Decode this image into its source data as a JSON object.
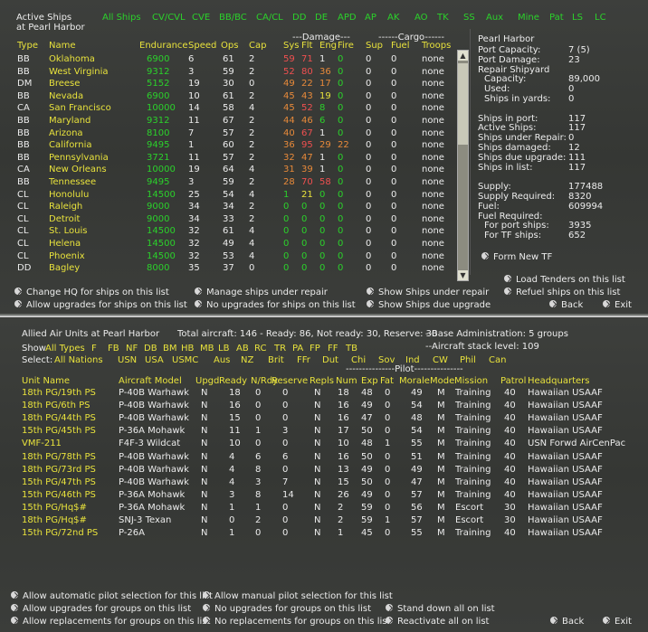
{
  "top": {
    "title_line1": "Active Ships",
    "title_line2": "at Pearl Harbor",
    "filters": [
      "All Ships",
      "CV/CVL",
      "CVE",
      "BB/BC",
      "CA/CL",
      "DD",
      "DE",
      "APD",
      "AP",
      "AK",
      "AO",
      "TK",
      "SS",
      "Aux",
      "Mine",
      "Pat",
      "LS",
      "LC"
    ],
    "damage_group": "---Damage---",
    "cargo_group": "------Cargo------",
    "columns": [
      "Type",
      "Name",
      "Endurance",
      "Speed",
      "Ops",
      "Cap",
      "Sys",
      "Flt",
      "Eng",
      "Fire",
      "Sup",
      "Fuel",
      "Troops"
    ],
    "ships": [
      {
        "type": "BB",
        "name": "Oklahoma",
        "end": "6900",
        "spd": "6",
        "ops": "61",
        "cap": "2",
        "sys": "59",
        "flt": "71",
        "eng": "1",
        "fire": "0",
        "sup": "0",
        "fuel": "0",
        "troops": "none",
        "sc": "rd",
        "fc": "rd",
        "ec": "wh",
        "xc": "gr"
      },
      {
        "type": "BB",
        "name": "West Virginia",
        "end": "9312",
        "spd": "3",
        "ops": "59",
        "cap": "2",
        "sys": "52",
        "flt": "80",
        "eng": "36",
        "fire": "0",
        "sup": "0",
        "fuel": "0",
        "troops": "none",
        "sc": "rd",
        "fc": "rd",
        "ec": "or",
        "xc": "gr"
      },
      {
        "type": "DM",
        "name": "Breese",
        "end": "5152",
        "spd": "19",
        "ops": "30",
        "cap": "0",
        "sys": "49",
        "flt": "22",
        "eng": "17",
        "fire": "0",
        "sup": "0",
        "fuel": "0",
        "troops": "none",
        "sc": "or",
        "fc": "or",
        "ec": "or",
        "xc": "gr"
      },
      {
        "type": "BB",
        "name": "Nevada",
        "end": "6900",
        "spd": "10",
        "ops": "61",
        "cap": "2",
        "sys": "45",
        "flt": "43",
        "eng": "19",
        "fire": "0",
        "sup": "0",
        "fuel": "0",
        "troops": "none",
        "sc": "or",
        "fc": "or",
        "ec": "ye",
        "xc": "gr"
      },
      {
        "type": "CA",
        "name": "San Francisco",
        "end": "10000",
        "spd": "14",
        "ops": "58",
        "cap": "4",
        "sys": "45",
        "flt": "52",
        "eng": "8",
        "fire": "0",
        "sup": "0",
        "fuel": "0",
        "troops": "none",
        "sc": "or",
        "fc": "rd",
        "ec": "gr",
        "xc": "gr"
      },
      {
        "type": "BB",
        "name": "Maryland",
        "end": "9312",
        "spd": "11",
        "ops": "67",
        "cap": "2",
        "sys": "44",
        "flt": "46",
        "eng": "6",
        "fire": "0",
        "sup": "0",
        "fuel": "0",
        "troops": "none",
        "sc": "or",
        "fc": "or",
        "ec": "gr",
        "xc": "gr"
      },
      {
        "type": "BB",
        "name": "Arizona",
        "end": "8100",
        "spd": "7",
        "ops": "57",
        "cap": "2",
        "sys": "40",
        "flt": "67",
        "eng": "1",
        "fire": "0",
        "sup": "0",
        "fuel": "0",
        "troops": "none",
        "sc": "or",
        "fc": "rd",
        "ec": "wh",
        "xc": "gr"
      },
      {
        "type": "BB",
        "name": "California",
        "end": "9495",
        "spd": "1",
        "ops": "60",
        "cap": "2",
        "sys": "36",
        "flt": "95",
        "eng": "29",
        "fire": "22",
        "sup": "0",
        "fuel": "0",
        "troops": "none",
        "sc": "or",
        "fc": "rd",
        "ec": "or",
        "xc": "or"
      },
      {
        "type": "BB",
        "name": "Pennsylvania",
        "end": "3721",
        "spd": "11",
        "ops": "57",
        "cap": "2",
        "sys": "32",
        "flt": "47",
        "eng": "1",
        "fire": "0",
        "sup": "0",
        "fuel": "0",
        "troops": "none",
        "sc": "or",
        "fc": "or",
        "ec": "wh",
        "xc": "gr"
      },
      {
        "type": "CA",
        "name": "New Orleans",
        "end": "10000",
        "spd": "19",
        "ops": "64",
        "cap": "4",
        "sys": "31",
        "flt": "39",
        "eng": "1",
        "fire": "0",
        "sup": "0",
        "fuel": "0",
        "troops": "none",
        "sc": "or",
        "fc": "or",
        "ec": "wh",
        "xc": "gr"
      },
      {
        "type": "BB",
        "name": "Tennessee",
        "end": "9495",
        "spd": "3",
        "ops": "59",
        "cap": "2",
        "sys": "28",
        "flt": "70",
        "eng": "58",
        "fire": "0",
        "sup": "0",
        "fuel": "0",
        "troops": "none",
        "sc": "or",
        "fc": "rd",
        "ec": "rd",
        "xc": "gr"
      },
      {
        "type": "CL",
        "name": "Honolulu",
        "end": "14500",
        "spd": "25",
        "ops": "54",
        "cap": "4",
        "sys": "1",
        "flt": "21",
        "eng": "0",
        "fire": "0",
        "sup": "0",
        "fuel": "0",
        "troops": "none",
        "sc": "gr",
        "fc": "ye",
        "ec": "gr",
        "xc": "gr"
      },
      {
        "type": "CL",
        "name": "Raleigh",
        "end": "9000",
        "spd": "34",
        "ops": "34",
        "cap": "2",
        "sys": "0",
        "flt": "0",
        "eng": "0",
        "fire": "0",
        "sup": "0",
        "fuel": "0",
        "troops": "none",
        "sc": "gr",
        "fc": "gr",
        "ec": "gr",
        "xc": "gr"
      },
      {
        "type": "CL",
        "name": "Detroit",
        "end": "9000",
        "spd": "34",
        "ops": "33",
        "cap": "2",
        "sys": "0",
        "flt": "0",
        "eng": "0",
        "fire": "0",
        "sup": "0",
        "fuel": "0",
        "troops": "none",
        "sc": "gr",
        "fc": "gr",
        "ec": "gr",
        "xc": "gr"
      },
      {
        "type": "CL",
        "name": "St. Louis",
        "end": "14500",
        "spd": "32",
        "ops": "61",
        "cap": "4",
        "sys": "0",
        "flt": "0",
        "eng": "0",
        "fire": "0",
        "sup": "0",
        "fuel": "0",
        "troops": "none",
        "sc": "gr",
        "fc": "gr",
        "ec": "gr",
        "xc": "gr"
      },
      {
        "type": "CL",
        "name": "Helena",
        "end": "14500",
        "spd": "32",
        "ops": "49",
        "cap": "4",
        "sys": "0",
        "flt": "0",
        "eng": "0",
        "fire": "0",
        "sup": "0",
        "fuel": "0",
        "troops": "none",
        "sc": "gr",
        "fc": "gr",
        "ec": "gr",
        "xc": "gr"
      },
      {
        "type": "CL",
        "name": "Phoenix",
        "end": "14500",
        "spd": "32",
        "ops": "53",
        "cap": "4",
        "sys": "0",
        "flt": "0",
        "eng": "0",
        "fire": "0",
        "sup": "0",
        "fuel": "0",
        "troops": "none",
        "sc": "gr",
        "fc": "gr",
        "ec": "gr",
        "xc": "gr"
      },
      {
        "type": "DD",
        "name": "Bagley",
        "end": "8000",
        "spd": "35",
        "ops": "37",
        "cap": "0",
        "sys": "0",
        "flt": "0",
        "eng": "0",
        "fire": "0",
        "sup": "0",
        "fuel": "0",
        "troops": "none",
        "sc": "gr",
        "fc": "gr",
        "ec": "gr",
        "xc": "gr"
      }
    ],
    "base": {
      "name": "Pearl Harbor",
      "rows": [
        {
          "label": "Port Capacity:",
          "value": "7 (5)",
          "indent": 0
        },
        {
          "label": "Port Damage:",
          "value": "23",
          "indent": 0
        },
        {
          "label": "Repair Shipyard",
          "value": "",
          "indent": 0
        },
        {
          "label": "Capacity:",
          "value": "89,000",
          "indent": 1
        },
        {
          "label": "Used:",
          "value": "0",
          "indent": 1
        },
        {
          "label": "Ships in yards:",
          "value": "0",
          "indent": 1
        },
        {
          "label": "",
          "value": "",
          "indent": 0
        },
        {
          "label": "Ships in port:",
          "value": "117",
          "indent": 0
        },
        {
          "label": "Active Ships:",
          "value": "117",
          "indent": 0
        },
        {
          "label": "Ships under Repair:",
          "value": "0",
          "indent": 0
        },
        {
          "label": "Ships damaged:",
          "value": "12",
          "indent": 0
        },
        {
          "label": "Ships due upgrade:",
          "value": "111",
          "indent": 0
        },
        {
          "label": "Ships in list:",
          "value": "117",
          "indent": 0
        },
        {
          "label": "",
          "value": "",
          "indent": 0
        },
        {
          "label": "Supply:",
          "value": "177488",
          "indent": 0
        },
        {
          "label": "Supply Required:",
          "value": "8320",
          "indent": 0
        },
        {
          "label": "Fuel:",
          "value": "609994",
          "indent": 0
        },
        {
          "label": "Fuel Required:",
          "value": "",
          "indent": 0
        },
        {
          "label": "For port ships:",
          "value": "3935",
          "indent": 1
        },
        {
          "label": "For TF ships:",
          "value": "652",
          "indent": 1
        }
      ],
      "form_new_tf": "Form New TF"
    },
    "buttons": {
      "change_hq": "Change HQ for ships on this list",
      "manage_repair": "Manage ships under repair",
      "show_repair": "Show Ships under repair",
      "load_tenders": "Load Tenders on this list",
      "allow_upgrades": "Allow upgrades for ships on this list",
      "no_upgrades": "No upgrades for ships on this list",
      "show_upgrade": "Show Ships due upgrade",
      "refuel": "Refuel ships on this list",
      "back": "Back",
      "exit": "Exit"
    }
  },
  "air": {
    "title": "Allied Air Units at Pearl Harbor",
    "summary": "Total aircraft: 146 - Ready: 86, Not ready: 30, Reserve: 30",
    "base_admin": "--Base Administration: 5 groups",
    "stack_level": "--Aircraft stack level: 109",
    "show_label": "Show",
    "show_filters": [
      "All Types",
      "F",
      "FB",
      "NF",
      "DB",
      "BM",
      "HB",
      "MB",
      "LB",
      "AB",
      "RC",
      "TR",
      "PA",
      "FP",
      "FF",
      "TB"
    ],
    "select_label": "Select:",
    "select_filters": [
      "All Nations",
      "USN",
      "USA",
      "USMC",
      "Aus",
      "NZ",
      "Brit",
      "FFr",
      "Dut",
      "Chi",
      "Sov",
      "Ind",
      "CW",
      "Phil",
      "Can"
    ],
    "pilot_group": "---------------Pilot---------------",
    "columns": [
      "Unit Name",
      "Aircraft Model",
      "Upgd",
      "Ready",
      "N/Rdy",
      "Reserve",
      "Repls",
      "Num",
      "Exp",
      "Fat",
      "Morale",
      "Mode",
      "Mission",
      "Patrol",
      "Headquarters"
    ],
    "units": [
      {
        "unit": "18th PG/19th PS",
        "model": "P-40B Warhawk",
        "upgd": "N",
        "rdy": "18",
        "nrdy": "0",
        "res": "0",
        "repl": "N",
        "num": "18",
        "exp": "48",
        "fat": "0",
        "mor": "49",
        "mode": "M",
        "mis": "Training",
        "pat": "40",
        "hq": "Hawaiian USAAF"
      },
      {
        "unit": "18th PG/6th PS",
        "model": "P-40B Warhawk",
        "upgd": "N",
        "rdy": "16",
        "nrdy": "0",
        "res": "0",
        "repl": "N",
        "num": "16",
        "exp": "49",
        "fat": "0",
        "mor": "54",
        "mode": "M",
        "mis": "Training",
        "pat": "40",
        "hq": "Hawaiian USAAF"
      },
      {
        "unit": "18th PG/44th PS",
        "model": "P-40B Warhawk",
        "upgd": "N",
        "rdy": "15",
        "nrdy": "0",
        "res": "0",
        "repl": "N",
        "num": "16",
        "exp": "47",
        "fat": "0",
        "mor": "48",
        "mode": "M",
        "mis": "Training",
        "pat": "40",
        "hq": "Hawaiian USAAF"
      },
      {
        "unit": "15th PG/45th PS",
        "model": "P-36A Mohawk",
        "upgd": "N",
        "rdy": "11",
        "nrdy": "1",
        "res": "3",
        "repl": "N",
        "num": "17",
        "exp": "50",
        "fat": "0",
        "mor": "54",
        "mode": "M",
        "mis": "Training",
        "pat": "40",
        "hq": "Hawaiian USAAF"
      },
      {
        "unit": "VMF-211",
        "model": "F4F-3 Wildcat",
        "upgd": "N",
        "rdy": "10",
        "nrdy": "0",
        "res": "0",
        "repl": "N",
        "num": "10",
        "exp": "48",
        "fat": "1",
        "mor": "55",
        "mode": "M",
        "mis": "Training",
        "pat": "40",
        "hq": "USN Forwd AirCenPac"
      },
      {
        "unit": "18th PG/78th PS",
        "model": "P-40B Warhawk",
        "upgd": "N",
        "rdy": "4",
        "nrdy": "6",
        "res": "6",
        "repl": "N",
        "num": "16",
        "exp": "50",
        "fat": "0",
        "mor": "51",
        "mode": "M",
        "mis": "Training",
        "pat": "40",
        "hq": "Hawaiian USAAF"
      },
      {
        "unit": "18th PG/73rd PS",
        "model": "P-40B Warhawk",
        "upgd": "N",
        "rdy": "4",
        "nrdy": "8",
        "res": "0",
        "repl": "N",
        "num": "13",
        "exp": "49",
        "fat": "0",
        "mor": "49",
        "mode": "M",
        "mis": "Training",
        "pat": "40",
        "hq": "Hawaiian USAAF"
      },
      {
        "unit": "15th PG/47th PS",
        "model": "P-40B Warhawk",
        "upgd": "N",
        "rdy": "4",
        "nrdy": "3",
        "res": "7",
        "repl": "N",
        "num": "15",
        "exp": "50",
        "fat": "0",
        "mor": "47",
        "mode": "M",
        "mis": "Training",
        "pat": "40",
        "hq": "Hawaiian USAAF"
      },
      {
        "unit": "15th PG/46th PS",
        "model": "P-36A Mohawk",
        "upgd": "N",
        "rdy": "3",
        "nrdy": "8",
        "res": "14",
        "repl": "N",
        "num": "26",
        "exp": "49",
        "fat": "0",
        "mor": "57",
        "mode": "M",
        "mis": "Training",
        "pat": "40",
        "hq": "Hawaiian USAAF"
      },
      {
        "unit": "15th PG/Hq$#",
        "model": "P-36A Mohawk",
        "upgd": "N",
        "rdy": "1",
        "nrdy": "1",
        "res": "0",
        "repl": "N",
        "num": "2",
        "exp": "59",
        "fat": "0",
        "mor": "56",
        "mode": "M",
        "mis": "Escort",
        "pat": "30",
        "hq": "Hawaiian USAAF"
      },
      {
        "unit": "18th PG/Hq$#",
        "model": "SNJ-3 Texan",
        "upgd": "N",
        "rdy": "0",
        "nrdy": "2",
        "res": "0",
        "repl": "N",
        "num": "2",
        "exp": "59",
        "fat": "1",
        "mor": "57",
        "mode": "M",
        "mis": "Escort",
        "pat": "30",
        "hq": "Hawaiian USAAF"
      },
      {
        "unit": "15th PG/72nd PS",
        "model": "P-26A",
        "upgd": "N",
        "rdy": "1",
        "nrdy": "0",
        "res": "0",
        "repl": "N",
        "num": "1",
        "exp": "45",
        "fat": "0",
        "mor": "55",
        "mode": "M",
        "mis": "Training",
        "pat": "40",
        "hq": "Hawaiian USAAF"
      }
    ],
    "buttons": {
      "auto_pilot": "Allow automatic pilot selection for this list",
      "manual_pilot": "Allow manual pilot selection for this list",
      "allow_upgrades": "Allow upgrades for groups on this list",
      "no_upgrades": "No upgrades for groups on this list",
      "stand_down": "Stand down all on list",
      "allow_repl": "Allow replacements for groups on this list",
      "no_repl": "No replacements for groups on this list",
      "reactivate": "Reactivate all on list",
      "back": "Back",
      "exit": "Exit"
    }
  }
}
